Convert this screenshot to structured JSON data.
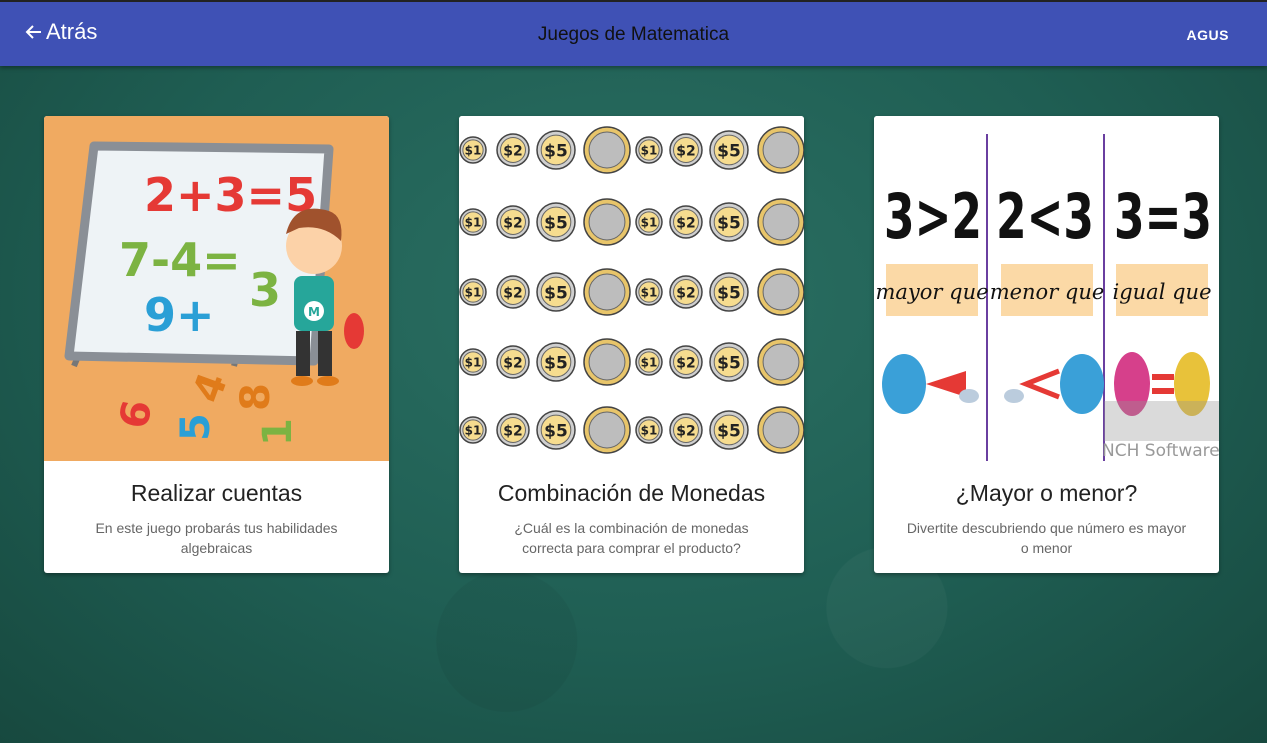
{
  "header": {
    "back_label": "Atrás",
    "title": "Juegos de Matematica",
    "user": "AGUS"
  },
  "cards": [
    {
      "title": "Realizar cuentas",
      "description": "En este juego probarás tus habilidades algebraicas",
      "image_text": [
        "2+3=5",
        "7-4=",
        "9+",
        "3",
        "M",
        "6",
        "5",
        "4",
        "8",
        "1"
      ]
    },
    {
      "title": "Combinación de Monedas",
      "description": "¿Cuál es la combinación de monedas correcta para comprar el producto?",
      "image_text": [
        "$1",
        "$2",
        "$5"
      ]
    },
    {
      "title": "¿Mayor o menor?",
      "description": "Divertite descubriendo que número es mayor o menor",
      "image_text": [
        "3>2",
        "2<3",
        "3=3",
        "mayor que",
        "menor que",
        "igual que",
        "NCH Software"
      ]
    }
  ],
  "colors": {
    "appbar": "#3f51b5",
    "background": "#1f5e53",
    "card": "#ffffff"
  }
}
